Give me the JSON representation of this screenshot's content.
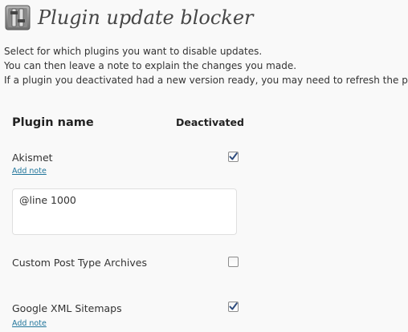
{
  "header": {
    "title": "Plugin update blocker",
    "icon": "plugins-icon"
  },
  "intro": {
    "line1": "Select for which plugins you want to disable updates.",
    "line2": "You can then leave a note to explain the changes you made.",
    "line3": "If a plugin you deactivated had a new version ready, you may need to refresh the page"
  },
  "table": {
    "col_plugin": "Plugin name",
    "col_deactivated": "Deactivated",
    "rows": [
      {
        "name": "Akismet",
        "deactivated": true,
        "add_note": "Add note",
        "note": "@line 1000"
      },
      {
        "name": "Custom Post Type Archives",
        "deactivated": false
      },
      {
        "name": "Google XML Sitemaps",
        "deactivated": true,
        "add_note": "Add note"
      }
    ]
  },
  "colors": {
    "link": "#21759b",
    "check": "#2c4a7c"
  }
}
